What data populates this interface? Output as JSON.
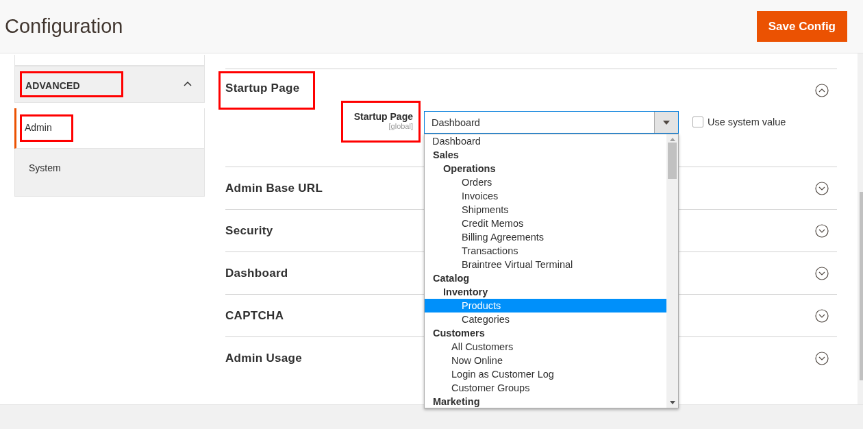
{
  "header": {
    "title": "Configuration",
    "save_button": "Save Config"
  },
  "sidebar": {
    "sections": [
      {
        "title": "ADVANCED",
        "expanded": true,
        "highlighted": true,
        "items": [
          {
            "label": "Admin",
            "selected": true,
            "highlighted": true
          },
          {
            "label": "System",
            "selected": false,
            "highlighted": false
          }
        ]
      }
    ]
  },
  "sections": [
    {
      "title": "Startup Page",
      "expanded": true,
      "highlighted": true,
      "fields": [
        {
          "label": "Startup Page",
          "scope": "[global]",
          "highlighted": true,
          "value": "Dashboard",
          "use_system_value": {
            "label": "Use system value",
            "checked": false
          },
          "dropdown": {
            "open": true,
            "options": [
              {
                "label": "Dashboard",
                "kind": "option",
                "selected": false
              },
              {
                "label": "Sales",
                "kind": "group",
                "selected": false,
                "children": [
                  {
                    "label": "Operations",
                    "kind": "group",
                    "selected": false,
                    "children": [
                      {
                        "label": "Orders",
                        "kind": "option",
                        "selected": false
                      },
                      {
                        "label": "Invoices",
                        "kind": "option",
                        "selected": false
                      },
                      {
                        "label": "Shipments",
                        "kind": "option",
                        "selected": false
                      },
                      {
                        "label": "Credit Memos",
                        "kind": "option",
                        "selected": false
                      },
                      {
                        "label": "Billing Agreements",
                        "kind": "option",
                        "selected": false
                      },
                      {
                        "label": "Transactions",
                        "kind": "option",
                        "selected": false
                      },
                      {
                        "label": "Braintree Virtual Terminal",
                        "kind": "option",
                        "selected": false
                      }
                    ]
                  }
                ]
              },
              {
                "label": "Catalog",
                "kind": "group",
                "selected": false,
                "children": [
                  {
                    "label": "Inventory",
                    "kind": "group",
                    "selected": false,
                    "children": [
                      {
                        "label": "Products",
                        "kind": "option",
                        "selected": true
                      },
                      {
                        "label": "Categories",
                        "kind": "option",
                        "selected": false
                      }
                    ]
                  }
                ]
              },
              {
                "label": "Customers",
                "kind": "group",
                "selected": false,
                "children": [
                  {
                    "label": "All Customers",
                    "kind": "option",
                    "selected": false
                  },
                  {
                    "label": "Now Online",
                    "kind": "option",
                    "selected": false
                  },
                  {
                    "label": "Login as Customer Log",
                    "kind": "option",
                    "selected": false
                  },
                  {
                    "label": "Customer Groups",
                    "kind": "option",
                    "selected": false
                  }
                ]
              },
              {
                "label": "Marketing",
                "kind": "group",
                "selected": false
              }
            ]
          }
        }
      ]
    },
    {
      "title": "Admin Base URL",
      "expanded": false,
      "highlighted": false
    },
    {
      "title": "Security",
      "expanded": false,
      "highlighted": false
    },
    {
      "title": "Dashboard",
      "expanded": false,
      "highlighted": false
    },
    {
      "title": "CAPTCHA",
      "expanded": false,
      "highlighted": false
    },
    {
      "title": "Admin Usage",
      "expanded": false,
      "highlighted": false
    }
  ]
}
